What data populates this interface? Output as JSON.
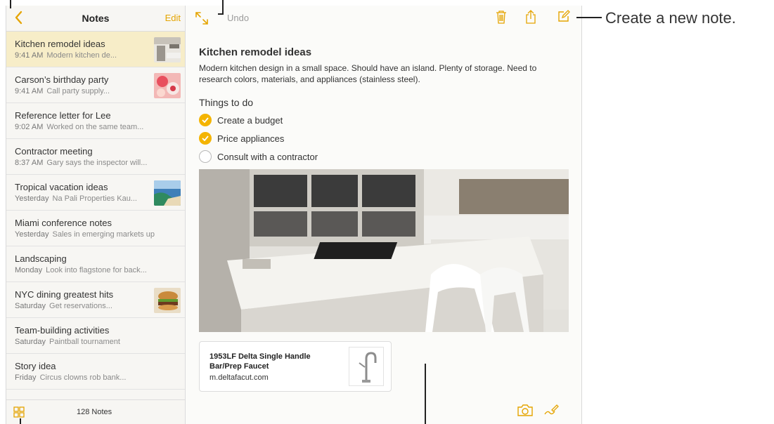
{
  "sidebar": {
    "title": "Notes",
    "edit_label": "Edit",
    "notes": [
      {
        "title": "Kitchen remodel ideas",
        "time": "9:41 AM",
        "preview": "Modern kitchen de...",
        "thumb": "kitchen"
      },
      {
        "title": "Carson’s birthday party",
        "time": "9:41 AM",
        "preview": "Call party supply...",
        "thumb": "cupcakes"
      },
      {
        "title": "Reference letter for Lee",
        "time": "9:02 AM",
        "preview": "Worked on the same team...",
        "thumb": ""
      },
      {
        "title": "Contractor meeting",
        "time": "8:37 AM",
        "preview": "Gary says the inspector will...",
        "thumb": ""
      },
      {
        "title": "Tropical vacation ideas",
        "time": "Yesterday",
        "preview": "Na Pali Properties Kau...",
        "thumb": "beach"
      },
      {
        "title": "Miami conference notes",
        "time": "Yesterday",
        "preview": "Sales in emerging markets up",
        "thumb": ""
      },
      {
        "title": "Landscaping",
        "time": "Monday",
        "preview": "Look into flagstone for back...",
        "thumb": ""
      },
      {
        "title": "NYC dining greatest hits",
        "time": "Saturday",
        "preview": "Get reservations...",
        "thumb": "burger"
      },
      {
        "title": "Team-building activities",
        "time": "Saturday",
        "preview": "Paintball tournament",
        "thumb": ""
      },
      {
        "title": "Story idea",
        "time": "Friday",
        "preview": "Circus clowns rob bank...",
        "thumb": ""
      }
    ],
    "count_label": "128 Notes"
  },
  "toolbar": {
    "undo_label": "Undo",
    "icons": [
      "expand-icon",
      "trash-icon",
      "share-icon",
      "compose-icon"
    ]
  },
  "note": {
    "title": "Kitchen remodel ideas",
    "body": "Modern kitchen design in a small space. Should have an island. Plenty of storage. Need to research colors, materials, and appliances (stainless steel).",
    "subheading": "Things to do",
    "checklist": [
      {
        "label": "Create a budget",
        "checked": true
      },
      {
        "label": "Price appliances",
        "checked": true
      },
      {
        "label": "Consult with a contractor",
        "checked": false
      }
    ],
    "link": {
      "title": "1953LF Delta Single Handle Bar/Prep Faucet",
      "url": "m.deltafacut.com"
    }
  },
  "callouts": {
    "create_note": "Create a new note."
  },
  "colors": {
    "accent": "#f4b400",
    "selected_row": "#f7edc8",
    "edit_text": "#e5a400"
  }
}
